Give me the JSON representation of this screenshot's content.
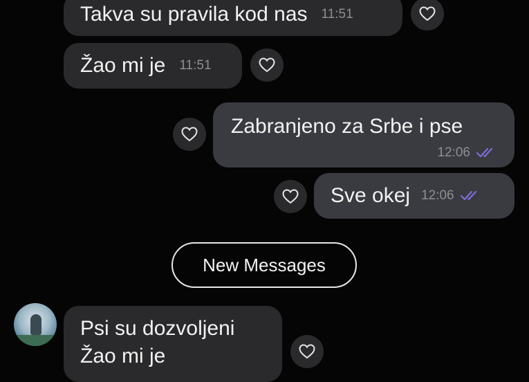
{
  "messages": [
    {
      "text": "Takva su pravila kod nas",
      "time": "11:51",
      "direction": "incoming"
    },
    {
      "text": "Žao mi je",
      "time": "11:51",
      "direction": "incoming"
    },
    {
      "text": "Zabranjeno za Srbe i pse",
      "time": "12:06",
      "direction": "outgoing",
      "status": "read"
    },
    {
      "text": "Sve okej",
      "time": "12:06",
      "direction": "outgoing",
      "status": "read"
    },
    {
      "text": "Psi su dozvoljeni",
      "text2": "Žao mi je",
      "direction": "incoming"
    }
  ],
  "divider": {
    "label": "New Messages"
  },
  "colors": {
    "background": "#050505",
    "incoming_bubble": "#2a2a2c",
    "outgoing_bubble": "#3a3b40",
    "read_ticks": "#7a6fd6",
    "timestamp": "#8e8e93"
  },
  "icons": {
    "reaction": "heart-outline-icon",
    "read_status": "double-check-icon"
  }
}
